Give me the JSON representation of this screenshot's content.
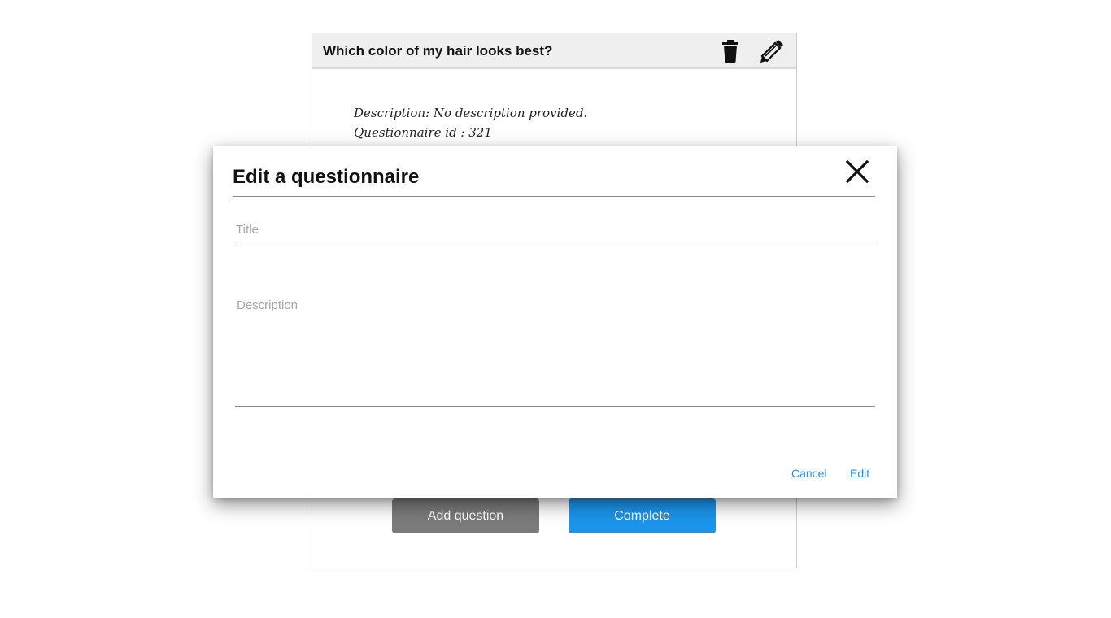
{
  "card": {
    "title": "Which color of my hair looks best?",
    "description_line": "Description: No description provided.",
    "id_line": "Questionnaire id : 321",
    "add_question_label": "Add question",
    "complete_label": "Complete",
    "icons": {
      "delete": "trash-icon",
      "edit": "pencil-icon"
    }
  },
  "modal": {
    "title": "Edit a questionnaire",
    "close_icon": "close-icon",
    "title_field": {
      "value": "",
      "placeholder": "Title"
    },
    "description_field": {
      "value": "",
      "placeholder": "Description"
    },
    "cancel_label": "Cancel",
    "edit_label": "Edit"
  },
  "colors": {
    "accent_blue": "#1b95ec",
    "link_blue": "#2a8fe0",
    "secondary_gray": "#7b7b7b",
    "header_bg": "#efefef"
  }
}
